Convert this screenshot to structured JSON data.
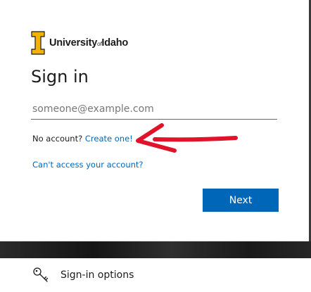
{
  "brand": {
    "name_part1": "University",
    "name_of": "of",
    "name_part2": "Idaho"
  },
  "title": "Sign in",
  "email": {
    "placeholder": "someone@example.com",
    "value": ""
  },
  "no_account": {
    "text": "No account?",
    "link": "Create one!"
  },
  "cant_access": "Can't access your account?",
  "next_button": "Next",
  "signin_options": {
    "label": "Sign-in options",
    "icon": "key-icon"
  },
  "colors": {
    "accent": "#0067b8",
    "brand_gold": "#f1b300",
    "annotation_arrow": "#e0132a"
  }
}
